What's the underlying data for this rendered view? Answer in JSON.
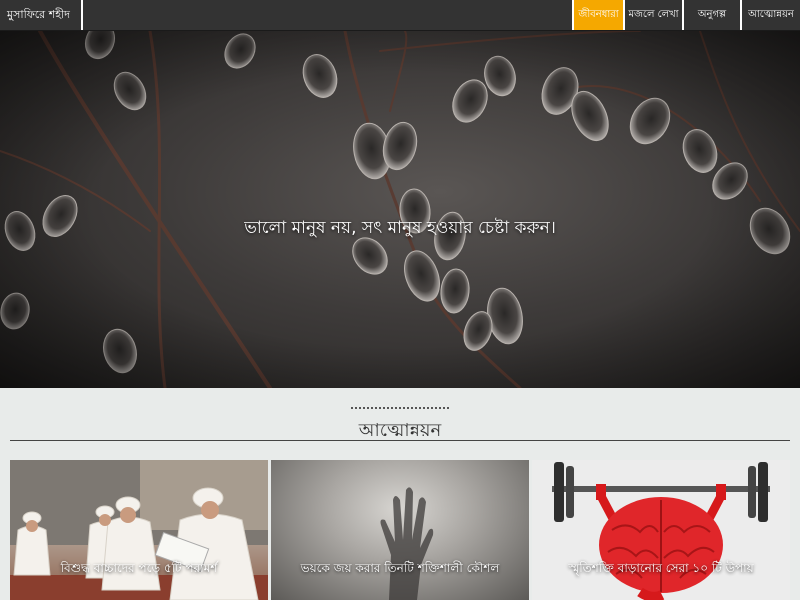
{
  "nav": {
    "brand": "মুসাফিরে শহীদ",
    "items": [
      {
        "label": "জীবনধারা",
        "active": true
      },
      {
        "label": "মজলে লেখা",
        "active": false
      },
      {
        "label": "অনুগল্প",
        "active": false
      },
      {
        "label": "আত্মোন্নয়ন",
        "active": false
      }
    ],
    "active_color": "#f5a800"
  },
  "hero": {
    "quote": "ভালো মানুষ নয়, সৎ মানুষ হওয়ার চেষ্টা করুন।"
  },
  "section": {
    "title": "আত্মোন্নয়ন"
  },
  "cards": [
    {
      "caption": "বিশুদ্ধ বাচ্চাদের পড়ে ৫টি পরামর্শ",
      "image": "children-reading-photo"
    },
    {
      "caption": "ভয়কে জয় করার তিনটি শক্তিশালী কৌশল",
      "image": "hand-behind-glass-photo"
    },
    {
      "caption": "স্মৃতিশক্তি বাড়ানোর সেরা ১০ টি উপায়",
      "image": "brain-barbell-photo"
    }
  ]
}
